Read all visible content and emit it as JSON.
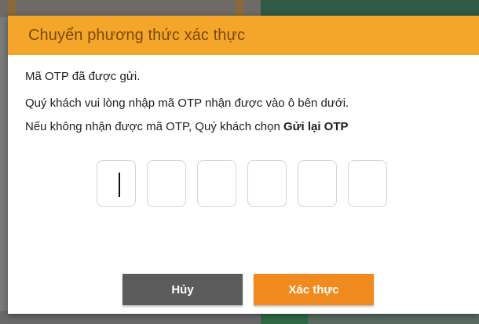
{
  "modal": {
    "title": "Chuyển phương thức xác thực",
    "message_sent": "Mã OTP đã được gửi.",
    "instruction": "Quý khách vui lòng nhập mã OTP nhận được vào ô bên dưới.",
    "resend_prefix": "Nếu không nhận được mã OTP, Quý khách chọn ",
    "resend_link": "Gửi lại OTP",
    "otp_fields": [
      "",
      "",
      "",
      "",
      "",
      ""
    ],
    "cancel_label": "Hủy",
    "confirm_label": "Xác thực"
  },
  "colors": {
    "header": "#f3a62a",
    "title_text": "#7a4a06",
    "cancel_button": "#5c5c5c",
    "confirm_button": "#f08a1e"
  }
}
